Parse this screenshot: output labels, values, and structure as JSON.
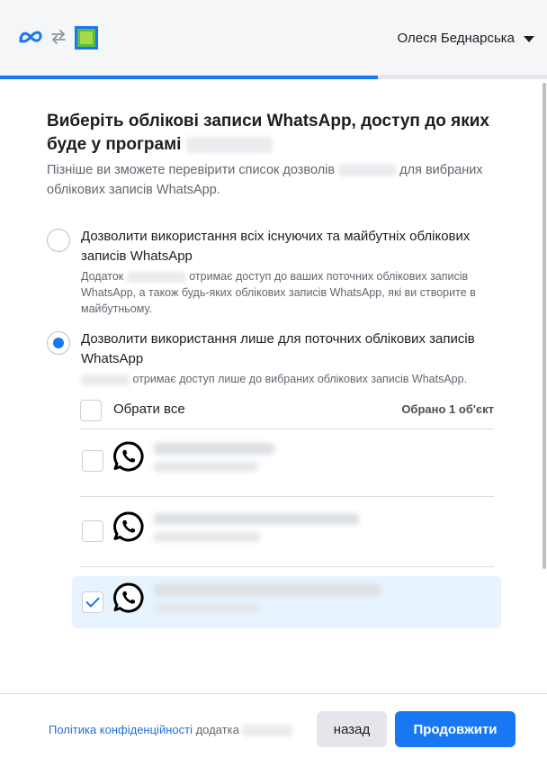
{
  "header": {
    "user_name": "Олеся Беднарська",
    "icons": [
      "meta-logo-icon",
      "swap-arrows-icon",
      "app-icon",
      "chevron-down-icon"
    ],
    "colors": {
      "brand_blue": "#1877f2",
      "app_icon_green": "#a3d94a"
    }
  },
  "progress": {
    "fraction": 0.69
  },
  "main": {
    "title": "Виберіть облікові записи WhatsApp, доступ до яких буде у програмі",
    "subtitle_before": "Пізніше ви зможете перевірити список дозволів",
    "subtitle_after": "для вибраних облікових записів WhatsApp."
  },
  "options": [
    {
      "title": "Дозволити використання всіх існуючих та майбутніх облікових записів WhatsApp",
      "desc_before": "Додаток",
      "desc_after": "отримає доступ до ваших поточних облікових записів WhatsApp, а також будь-яких облікових записів WhatsApp, які ви створите в майбутньому.",
      "selected": false
    },
    {
      "title": "Дозволити використання лише для поточних облікових записів WhatsApp",
      "desc_after": "отримає доступ лише до вибраних облікових записів WhatsApp.",
      "selected": true
    }
  ],
  "account_list": {
    "select_all_label": "Обрати все",
    "selected_count": "Обрано 1 об'єкт",
    "accounts": [
      {
        "icon": "whatsapp-icon",
        "checked": false
      },
      {
        "icon": "whatsapp-icon",
        "checked": false
      },
      {
        "icon": "whatsapp-icon",
        "checked": true
      }
    ]
  },
  "footer": {
    "privacy_link": "Політика конфіденційності",
    "privacy_suffix": "додатка",
    "back_label": "назад",
    "continue_label": "Продовжити"
  }
}
